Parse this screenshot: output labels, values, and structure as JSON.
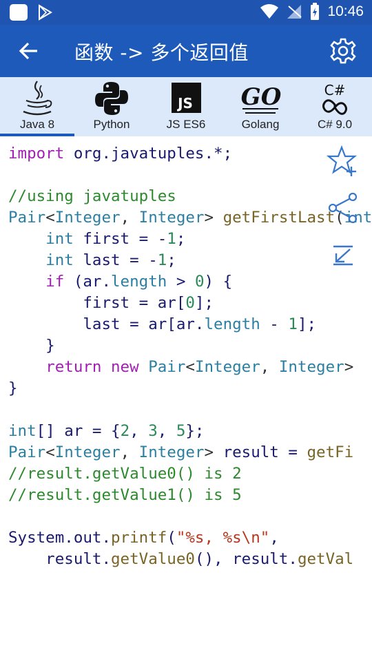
{
  "status_bar": {
    "time": "10:46"
  },
  "app_bar": {
    "title": "函数 -> 多个返回值"
  },
  "tabs": [
    {
      "label": "Java 8",
      "icon": "java-icon",
      "active": true
    },
    {
      "label": "Python",
      "icon": "python-icon",
      "active": false
    },
    {
      "label": "JS ES6",
      "icon": "js-icon",
      "active": false
    },
    {
      "label": "Golang",
      "icon": "golang-icon",
      "active": false
    },
    {
      "label": "C# 9.0",
      "icon": "csharp-icon",
      "active": false
    }
  ],
  "code_lines": [
    [
      [
        "kw",
        "import"
      ],
      [
        "pl",
        " org.javatuples.*;"
      ]
    ],
    [],
    [
      [
        "cm",
        "//using javatuples"
      ]
    ],
    [
      [
        "ty",
        "Pair"
      ],
      [
        "op",
        "<"
      ],
      [
        "ty",
        "Integer"
      ],
      [
        "op",
        ", "
      ],
      [
        "ty",
        "Integer"
      ],
      [
        "op",
        "> "
      ],
      [
        "fn",
        "getFirstLast"
      ],
      [
        "op",
        "("
      ],
      [
        "ty",
        "int"
      ]
    ],
    [
      [
        "pl",
        "    "
      ],
      [
        "ty",
        "int"
      ],
      [
        "pl",
        " first = -"
      ],
      [
        "nu",
        "1"
      ],
      [
        "pl",
        ";"
      ]
    ],
    [
      [
        "pl",
        "    "
      ],
      [
        "ty",
        "int"
      ],
      [
        "pl",
        " last = -"
      ],
      [
        "nu",
        "1"
      ],
      [
        "pl",
        ";"
      ]
    ],
    [
      [
        "pl",
        "    "
      ],
      [
        "kw",
        "if"
      ],
      [
        "pl",
        " ("
      ],
      [
        "pl",
        "ar."
      ],
      [
        "ty",
        "length"
      ],
      [
        "pl",
        " > "
      ],
      [
        "nu",
        "0"
      ],
      [
        "pl",
        ") {"
      ]
    ],
    [
      [
        "pl",
        "        first = ar["
      ],
      [
        "nu",
        "0"
      ],
      [
        "pl",
        "];"
      ]
    ],
    [
      [
        "pl",
        "        last = ar[ar."
      ],
      [
        "ty",
        "length"
      ],
      [
        "pl",
        " - "
      ],
      [
        "nu",
        "1"
      ],
      [
        "pl",
        "];"
      ]
    ],
    [
      [
        "pl",
        "    }"
      ]
    ],
    [
      [
        "pl",
        "    "
      ],
      [
        "kw",
        "return"
      ],
      [
        "pl",
        " "
      ],
      [
        "kw",
        "new"
      ],
      [
        "pl",
        " "
      ],
      [
        "ty",
        "Pair"
      ],
      [
        "op",
        "<"
      ],
      [
        "ty",
        "Integer"
      ],
      [
        "op",
        ", "
      ],
      [
        "ty",
        "Integer"
      ],
      [
        "op",
        ">"
      ]
    ],
    [
      [
        "pl",
        "}"
      ]
    ],
    [],
    [
      [
        "ty",
        "int"
      ],
      [
        "pl",
        "[] ar = {"
      ],
      [
        "nu",
        "2"
      ],
      [
        "pl",
        ", "
      ],
      [
        "nu",
        "3"
      ],
      [
        "pl",
        ", "
      ],
      [
        "nu",
        "5"
      ],
      [
        "pl",
        "};"
      ]
    ],
    [
      [
        "ty",
        "Pair"
      ],
      [
        "op",
        "<"
      ],
      [
        "ty",
        "Integer"
      ],
      [
        "op",
        ", "
      ],
      [
        "ty",
        "Integer"
      ],
      [
        "op",
        "> "
      ],
      [
        "pl",
        "result = "
      ],
      [
        "fn",
        "getFi"
      ]
    ],
    [
      [
        "cm",
        "//result.getValue0() is 2"
      ]
    ],
    [
      [
        "cm",
        "//result.getValue1() is 5"
      ]
    ],
    [],
    [
      [
        "pl",
        "System.out."
      ],
      [
        "fn",
        "printf"
      ],
      [
        "pl",
        "("
      ],
      [
        "st",
        "\"%s, %s\\n\""
      ],
      [
        "pl",
        ","
      ]
    ],
    [
      [
        "pl",
        "    result."
      ],
      [
        "fn",
        "getValue0"
      ],
      [
        "pl",
        "(), result."
      ],
      [
        "fn",
        "getVal"
      ]
    ]
  ],
  "colors": {
    "status_bar": "#1f55b0",
    "app_bar": "#1e5ab9",
    "tab_bar": "#dbe9fb",
    "accent": "#1e5ab9"
  }
}
